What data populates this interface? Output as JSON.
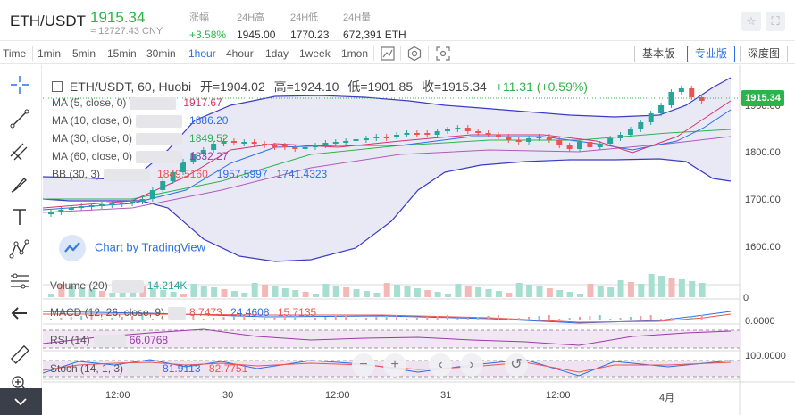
{
  "ticker": {
    "pair": "ETH/USDT",
    "price": "1915.34",
    "price_cny": "≈ 12727.43 CNY",
    "stats": [
      {
        "label": "涨幅",
        "value": "+3.58%"
      },
      {
        "label": "24H高",
        "value": "1945.00"
      },
      {
        "label": "24H低",
        "value": "1770.23"
      },
      {
        "label": "24H量",
        "value": "672,391 ETH"
      }
    ],
    "star_icon": "☆",
    "fullscreen_icon": "⛶"
  },
  "toolbar": {
    "intervals": [
      "Time",
      "1min",
      "5min",
      "15min",
      "30min",
      "1hour",
      "4hour",
      "1day",
      "1week",
      "1mon"
    ],
    "active_interval": "1hour",
    "views": [
      "基本版",
      "专业版",
      "深度图"
    ],
    "active_view": "专业版"
  },
  "chart": {
    "header": {
      "symbol": "ETH/USDT, 60, Huobi",
      "open": "开=1904.02",
      "high": "高=1924.10",
      "low": "低=1901.85",
      "close": "收=1915.34",
      "change": "+11.31 (+0.59%)"
    },
    "indicators": [
      {
        "name": "MA (5, close, 0)",
        "value": "1917.67",
        "color": "#d6336c"
      },
      {
        "name": "MA (10, close, 0)",
        "value": "1886.20",
        "color": "#2a6ee8"
      },
      {
        "name": "MA (30, close, 0)",
        "value": "1849.52",
        "color": "#2eb34b"
      },
      {
        "name": "MA (60, close, 0)",
        "value": "1832.27",
        "color": "#9b3aa8"
      }
    ],
    "bb": {
      "name": "BB (30, 3)",
      "v1": "1849.5160",
      "v2": "1957.5997",
      "v3": "1741.4323"
    },
    "tv_badge": "Chart by TradingView",
    "price_axis": [
      "1900.00",
      "1800.00",
      "1700.00",
      "1600.00"
    ],
    "current_price": "1915.34",
    "x_axis": [
      "12:00",
      "30",
      "12:00",
      "31",
      "12:00",
      "4月"
    ],
    "volume": {
      "name": "Volume (20)",
      "value": "14.214K",
      "axis": "0"
    },
    "macd": {
      "name": "MACD (12, 26, close, 9)",
      "v1": "8.7473",
      "v2": "24.4608",
      "v3": "15.7135",
      "axis": "0.0000"
    },
    "rsi": {
      "name": "RSI (14)",
      "value": "66.0768"
    },
    "stoch": {
      "name": "Stoch (14, 1, 3)",
      "v1": "81.9113",
      "v2": "82.7751",
      "axis": "100.0000"
    },
    "nav": {
      "zoom_out": "−",
      "zoom_in": "+",
      "prev": "‹",
      "next": "›",
      "reset": "↺"
    },
    "colors": {
      "up": "#26a69a",
      "down": "#ef5350",
      "bb_fill": "#e3e4f4",
      "bb_line": "#3b3bc6"
    }
  }
}
